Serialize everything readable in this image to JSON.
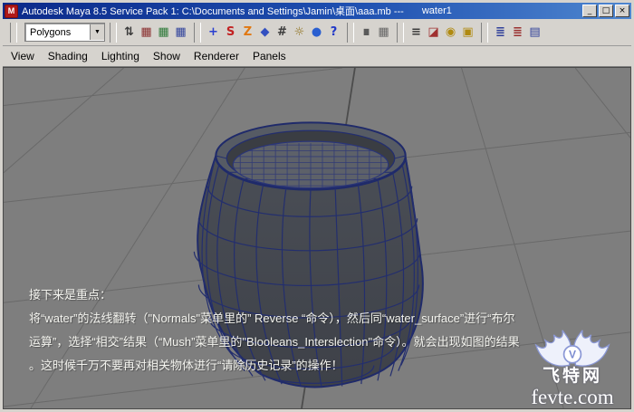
{
  "window": {
    "title": "Autodesk Maya 8.5 Service Pack 1: C:\\Documents and Settings\\Jamin\\桌面\\aaa.mb  ---",
    "document": "water1",
    "app_letter": "M",
    "controls": {
      "minimize": "_",
      "maximize": "□",
      "close": "×"
    }
  },
  "toolbar": {
    "menu_set": "Polygons",
    "dropdown_arrow": "▼",
    "groups": [
      {
        "icons": [
          {
            "name": "show-manipulator-icon",
            "glyph": "⇅",
            "color": "#3a3a3a"
          },
          {
            "name": "snap-to-grid-icon",
            "glyph": "▦",
            "color": "#8a2f2f"
          },
          {
            "name": "snap-to-curve-icon",
            "glyph": "▦",
            "color": "#2f7a3a"
          },
          {
            "name": "snap-to-point-icon",
            "glyph": "▦",
            "color": "#32449c"
          }
        ]
      },
      {
        "icons": [
          {
            "name": "plus-icon",
            "glyph": "+",
            "color": "#2a3fd0"
          },
          {
            "name": "input-connections-icon",
            "glyph": "S",
            "color": "#c22222"
          },
          {
            "name": "output-connections-icon",
            "glyph": "Z",
            "color": "#e07812"
          },
          {
            "name": "construction-history-icon",
            "glyph": "◆",
            "color": "#3350c0"
          },
          {
            "name": "grid-icon",
            "glyph": "#",
            "color": "#3a3a3a"
          },
          {
            "name": "light-icon",
            "glyph": "☼",
            "color": "#8a6a10"
          },
          {
            "name": "render-globe-icon",
            "glyph": "●",
            "color": "#2a5fd0"
          },
          {
            "name": "help-icon",
            "glyph": "?",
            "color": "#2038c8"
          }
        ]
      },
      {
        "icons": [
          {
            "name": "lock-icon",
            "glyph": "∎",
            "color": "#5a5a5a"
          },
          {
            "name": "grid-snap-icon",
            "glyph": "▦",
            "color": "#666666"
          }
        ]
      },
      {
        "icons": [
          {
            "name": "history-list-icon",
            "glyph": "≡",
            "color": "#3a3a3a"
          },
          {
            "name": "paint-bucket-icon",
            "glyph": "◪",
            "color": "#a03030"
          },
          {
            "name": "render-settings-icon",
            "glyph": "◉",
            "color": "#b08a10"
          },
          {
            "name": "texture-icon",
            "glyph": "▣",
            "color": "#b08a10"
          }
        ]
      },
      {
        "icons": [
          {
            "name": "attribute-editor-icon",
            "glyph": "≣",
            "color": "#30409a"
          },
          {
            "name": "tool-settings-icon",
            "glyph": "≣",
            "color": "#9a3030"
          },
          {
            "name": "channel-box-icon",
            "glyph": "▤",
            "color": "#30409a"
          }
        ]
      }
    ]
  },
  "panel_menu": {
    "items": [
      "View",
      "Shading",
      "Lighting",
      "Show",
      "Renderer",
      "Panels"
    ]
  },
  "viewport": {
    "overlay": {
      "lines": [
        "接下来是重点：",
        "将“water”的法线翻转（\"Normals\"菜单里的” Reverse “命令），然后同“water_surface”进行“布尔",
        "运算”，选择“相交”结果（“Mush”菜单里的\"Blooleans_Interslection\"命令）。就会出现如图的结果",
        "。这时候千万不要再对相关物体进行“请除历史记录”的操作！"
      ]
    },
    "watermark": {
      "site_name": "飞特网",
      "site_url": "fevte.com",
      "logo_letter": "V"
    },
    "colors": {
      "background": "#7e7e7e",
      "grid_line": "#696969",
      "axis_line": "#4c4c4c",
      "wireframe": "#232e6e",
      "model_surface": "#45484e"
    }
  }
}
